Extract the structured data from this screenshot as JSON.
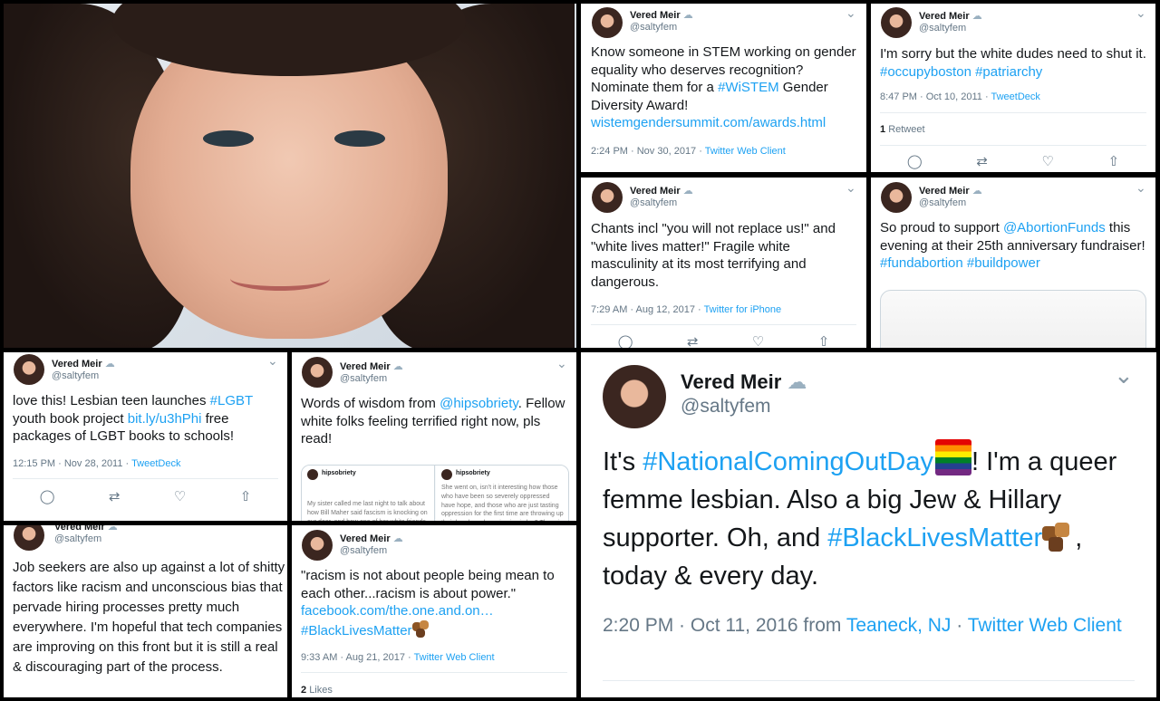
{
  "user": {
    "name": "Vered Meir",
    "handle": "@saltyfem"
  },
  "icons": {
    "verified_cloud": "cloud-icon",
    "chevron": "chevron-down-icon",
    "reply": "reply-icon",
    "retweet": "retweet-icon",
    "like": "heart-icon",
    "share": "share-icon"
  },
  "glyphs": {
    "cloud": "☁",
    "chevron": "⌄",
    "reply": "◯",
    "retweet": "⇄",
    "like": "♡",
    "share": "⇧"
  },
  "tweets": {
    "wistem": {
      "text_a": "Know someone in STEM working on gender equality who deserves recognition? Nominate them for a ",
      "tag": "#WiSTEM",
      "text_b": " Gender Diversity Award! ",
      "url": "wistemgendersummit.com/awards.html",
      "time": "2:24 PM · Nov 30, 2017 · ",
      "source": "Twitter Web Client"
    },
    "occupy": {
      "text": "I'm sorry but the white dudes need to shut it. ",
      "tag1": "#occupyboston",
      "tag2": "#patriarchy",
      "time": "8:47 PM · Oct 10, 2011 · ",
      "source": "TweetDeck",
      "retweet_count": "1",
      "retweet_label": "Retweet"
    },
    "chants": {
      "text": "Chants incl \"you will not replace us!\" and \"white lives matter!\" Fragile white masculinity at its most terrifying and dangerous.",
      "time": "7:29 AM · Aug 12, 2017 · ",
      "source": "Twitter for iPhone"
    },
    "abortion": {
      "text_a": "So proud to support ",
      "mention": "@AbortionFunds",
      "text_b": " this evening at their 25th anniversary fundraiser! ",
      "tag1": "#fundabortion",
      "tag2": "#buildpower"
    },
    "lgbt": {
      "text_a": "love this! Lesbian teen launches ",
      "tag": "#LGBT",
      "text_b": " youth book project ",
      "url": "bit.ly/u3hPhi",
      "text_c": "  free packages of LGBT books to schools!",
      "time": "12:15 PM · Nov 28, 2011 · ",
      "source": "TweetDeck"
    },
    "wisdom": {
      "text_a": "Words of wisdom from ",
      "mention": "@hipsobriety",
      "text_b": ". Fellow white folks feeling terrified right now, pls read!",
      "embed_user": "hipsobriety",
      "embed_left": "My sister called me last night to talk about how Bill Maher said fascism is knocking on our door, and how one of her white friends messaged her",
      "embed_right": "She went on, isn't it interesting how those who have been so severely oppressed have hope, and those who are just tasting oppression for the first time are throwing up their hands and running in circles? There is a reason I'm using my platform"
    },
    "jobs": {
      "text": "Job seekers are also up against a lot of shitty factors like racism and unconscious bias that pervade hiring processes pretty much everywhere. I'm hopeful that tech companies are improving on this front but it is still a real & discouraging part of the process."
    },
    "racism": {
      "text": "\"racism is not about people being mean to each other...racism is about power.\" ",
      "url": "facebook.com/the.one.and.on…",
      "tag": "#BlackLivesMatter",
      "time": "9:33 AM · Aug 21, 2017 · ",
      "source": "Twitter Web Client",
      "likes_count": "2",
      "likes_label": "Likes"
    },
    "coming_out": {
      "text_a": "It's ",
      "tag1": "#NationalComingOutDay",
      "text_b": "! I'm a queer femme lesbian. Also a big Jew & Hillary supporter. Oh, and ",
      "tag2": "#BlackLivesMatter",
      "text_c": ", today & every day.",
      "time": "2:20 PM · Oct 11, 2016 from ",
      "location": "Teaneck, NJ",
      "sep": " · ",
      "source": "Twitter Web Client"
    }
  },
  "colors": {
    "link": "#1da1f2",
    "meta": "#657786",
    "text": "#14171a",
    "divider": "#e6ecf0"
  }
}
